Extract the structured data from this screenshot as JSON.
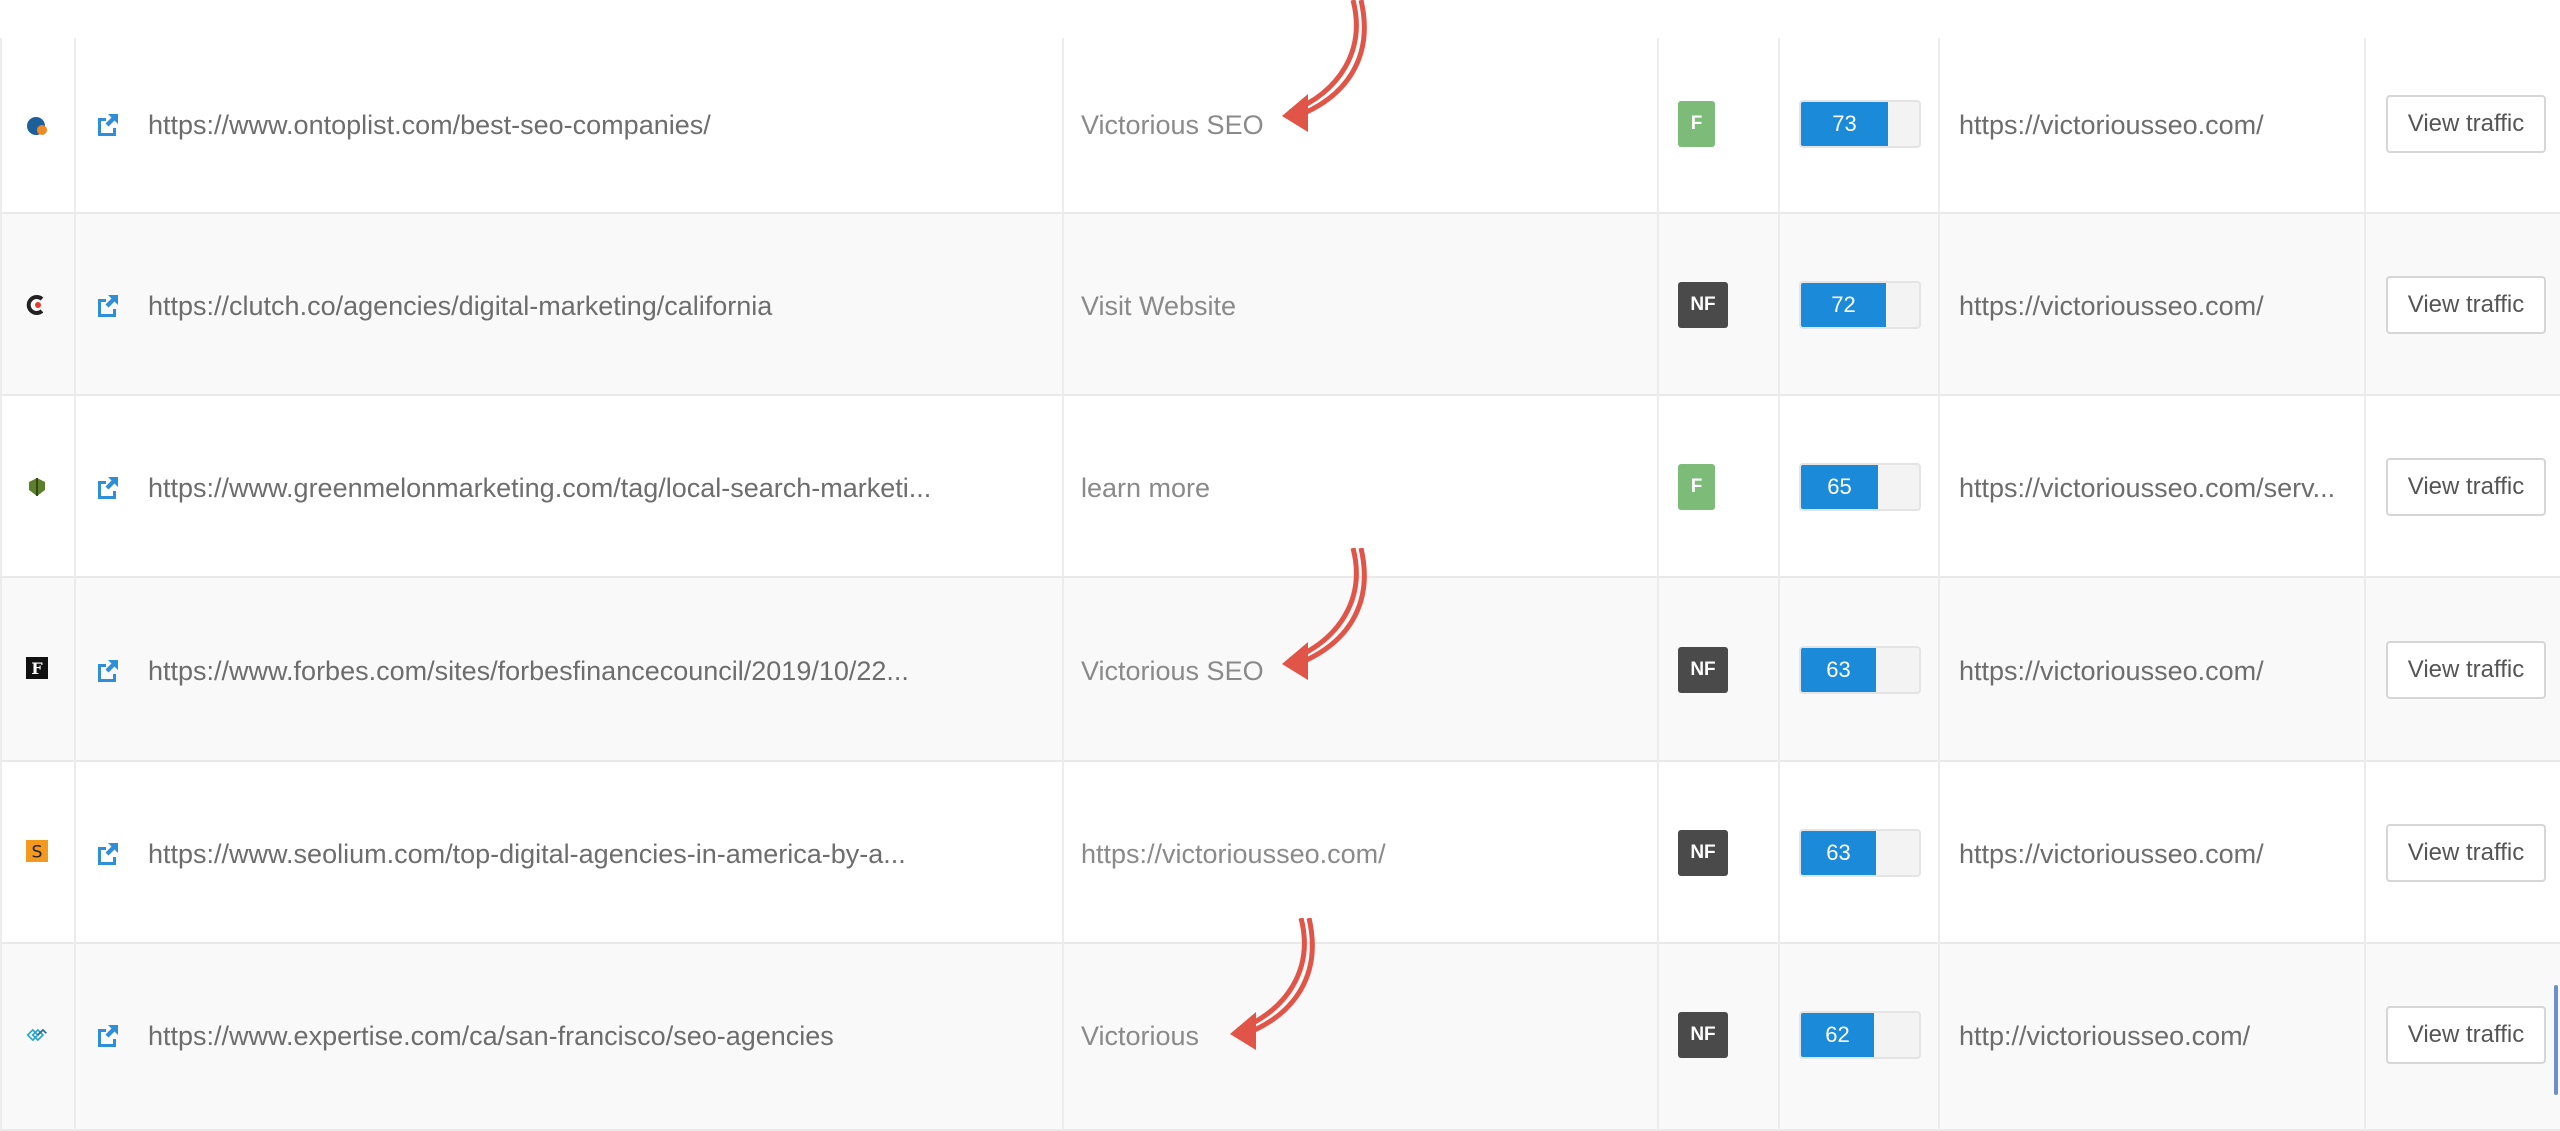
{
  "accent_colors": {
    "follow": "#7dbb79",
    "nofollow": "#4a4a4a",
    "score": "#1a8ad9",
    "annotation_arrow": "#e05548"
  },
  "rows": [
    {
      "favicon": "ontoplist-favicon",
      "source_url": "https://www.ontoplist.com/best-seo-companies/",
      "anchor": "Victorious SEO",
      "link_type": "F",
      "score": 73,
      "target_url": "https://victoriousseo.com/",
      "button": "View traffic",
      "highlighted": true
    },
    {
      "favicon": "clutch-favicon",
      "source_url": "https://clutch.co/agencies/digital-marketing/california",
      "anchor": "Visit Website",
      "link_type": "NF",
      "score": 72,
      "target_url": "https://victoriousseo.com/",
      "button": "View traffic",
      "highlighted": false
    },
    {
      "favicon": "greenmelon-favicon",
      "source_url": "https://www.greenmelonmarketing.com/tag/local-search-marketi...",
      "anchor": "learn more",
      "link_type": "F",
      "score": 65,
      "target_url": "https://victoriousseo.com/serv...",
      "button": "View traffic",
      "highlighted": false
    },
    {
      "favicon": "forbes-favicon",
      "source_url": "https://www.forbes.com/sites/forbesfinancecouncil/2019/10/22...",
      "anchor": "Victorious SEO",
      "link_type": "NF",
      "score": 63,
      "target_url": "https://victoriousseo.com/",
      "button": "View traffic",
      "highlighted": true
    },
    {
      "favicon": "seolium-favicon",
      "source_url": "https://www.seolium.com/top-digital-agencies-in-america-by-a...",
      "anchor": "https://victoriousseo.com/",
      "link_type": "NF",
      "score": 63,
      "target_url": "https://victoriousseo.com/",
      "button": "View traffic",
      "highlighted": false
    },
    {
      "favicon": "expertise-favicon",
      "source_url": "https://www.expertise.com/ca/san-francisco/seo-agencies",
      "anchor": "Victorious",
      "link_type": "NF",
      "score": 62,
      "target_url": "http://victoriousseo.com/",
      "button": "View traffic",
      "highlighted": true
    }
  ]
}
